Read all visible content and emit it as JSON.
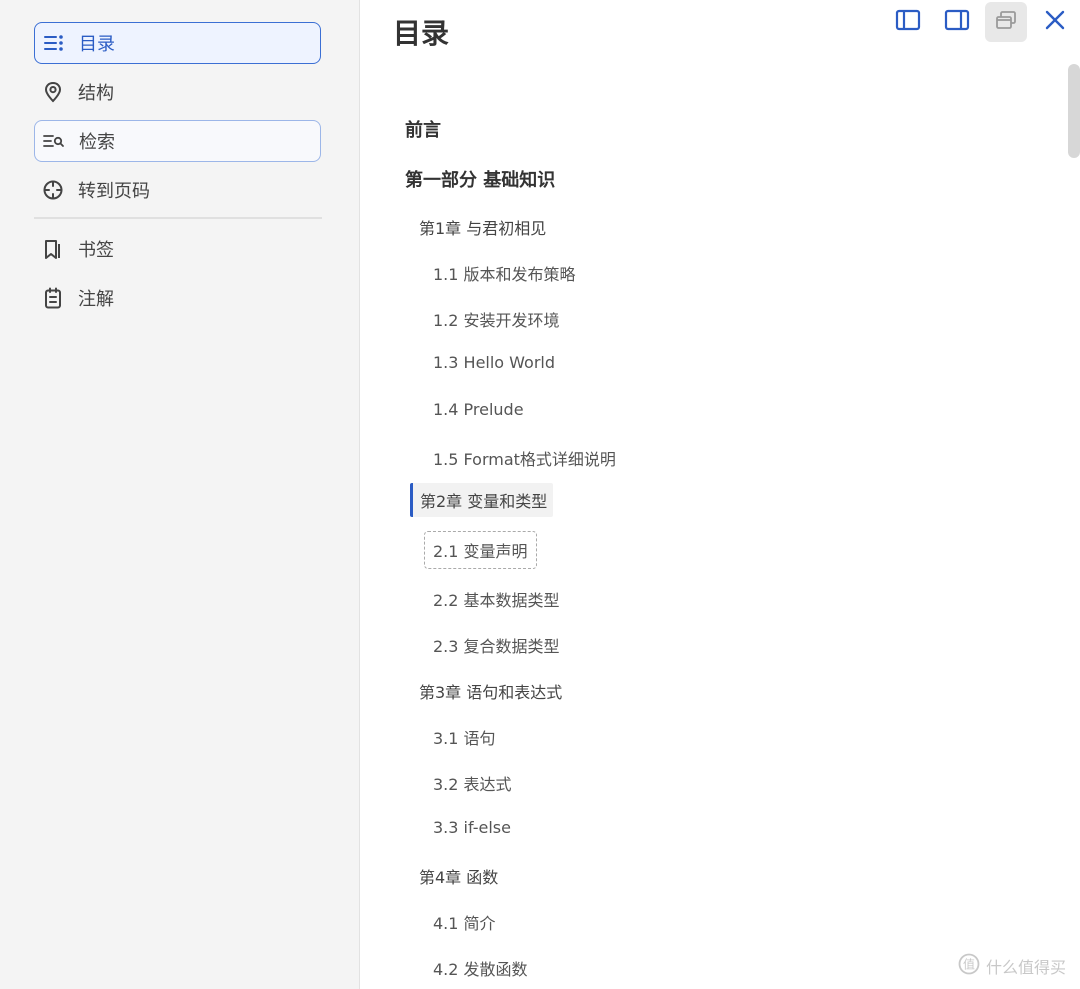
{
  "sidebar": {
    "items": [
      {
        "label": "目录",
        "icon": "list-icon",
        "state": "selected"
      },
      {
        "label": "结构",
        "icon": "map-pin-icon",
        "state": "normal"
      },
      {
        "label": "检索",
        "icon": "search-list-icon",
        "state": "focused"
      },
      {
        "label": "转到页码",
        "icon": "crosshair-icon",
        "state": "normal"
      },
      {
        "label": "书签",
        "icon": "bookmark-icon",
        "state": "normal"
      },
      {
        "label": "注解",
        "icon": "clipboard-icon",
        "state": "normal"
      }
    ]
  },
  "main": {
    "title": "目录",
    "toolbar": [
      {
        "name": "left-panel-icon"
      },
      {
        "name": "right-panel-icon"
      },
      {
        "name": "stacked-windows-icon",
        "active": true
      },
      {
        "name": "close-icon"
      }
    ],
    "toc": [
      {
        "text": "前言",
        "level": "part"
      },
      {
        "text": "第一部分 基础知识",
        "level": "part"
      },
      {
        "text": "第1章 与君初相见",
        "level": "chapter"
      },
      {
        "text": "1.1 版本和发布策略",
        "level": "section"
      },
      {
        "text": "1.2 安装开发环境",
        "level": "section"
      },
      {
        "text": "1.3 Hello World",
        "level": "section"
      },
      {
        "text": "1.4 Prelude",
        "level": "section"
      },
      {
        "text": "1.5 Format格式详细说明",
        "level": "section"
      },
      {
        "text": "第2章 变量和类型",
        "level": "chapter",
        "state": "current"
      },
      {
        "text": "2.1 变量声明",
        "level": "section",
        "state": "dashed"
      },
      {
        "text": "2.2 基本数据类型",
        "level": "section"
      },
      {
        "text": "2.3 复合数据类型",
        "level": "section"
      },
      {
        "text": "第3章 语句和表达式",
        "level": "chapter"
      },
      {
        "text": "3.1 语句",
        "level": "section"
      },
      {
        "text": "3.2 表达式",
        "level": "section"
      },
      {
        "text": "3.3 if-else",
        "level": "section"
      },
      {
        "text": "第4章 函数",
        "level": "chapter"
      },
      {
        "text": "4.1 简介",
        "level": "section"
      },
      {
        "text": "4.2 发散函数",
        "level": "section"
      }
    ]
  },
  "watermark": {
    "text": "什么值得买"
  },
  "colors": {
    "accent": "#2b5cc4",
    "sidebar_bg": "#f4f4f4",
    "text": "#444444"
  }
}
